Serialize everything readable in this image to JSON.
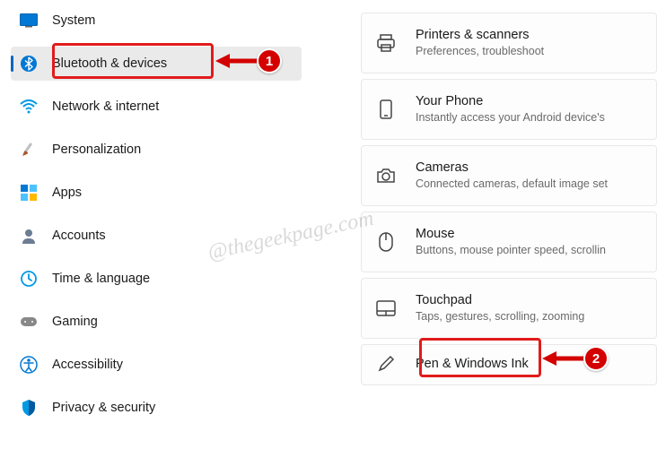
{
  "sidebar": {
    "items": [
      {
        "label": "System"
      },
      {
        "label": "Bluetooth & devices"
      },
      {
        "label": "Network & internet"
      },
      {
        "label": "Personalization"
      },
      {
        "label": "Apps"
      },
      {
        "label": "Accounts"
      },
      {
        "label": "Time & language"
      },
      {
        "label": "Gaming"
      },
      {
        "label": "Accessibility"
      },
      {
        "label": "Privacy & security"
      }
    ],
    "selected_index": 1
  },
  "main": {
    "cards": [
      {
        "title": "Printers & scanners",
        "subtitle": "Preferences, troubleshoot"
      },
      {
        "title": "Your Phone",
        "subtitle": "Instantly access your Android device's"
      },
      {
        "title": "Cameras",
        "subtitle": "Connected cameras, default image set"
      },
      {
        "title": "Mouse",
        "subtitle": "Buttons, mouse pointer speed, scrollin"
      },
      {
        "title": "Touchpad",
        "subtitle": "Taps, gestures, scrolling, zooming"
      },
      {
        "title": "Pen & Windows Ink",
        "subtitle": ""
      }
    ]
  },
  "annotations": {
    "badge1": "1",
    "badge2": "2"
  },
  "watermark": "@thegeekpage.com"
}
